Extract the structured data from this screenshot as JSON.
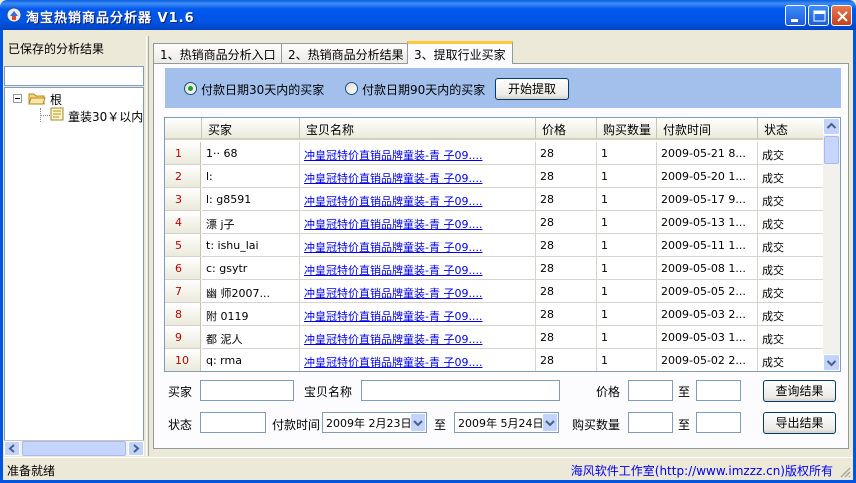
{
  "window": {
    "title": "淘宝热销商品分析器 V1.6"
  },
  "left_panel": {
    "label": "已保存的分析结果",
    "search_value": "",
    "tree": {
      "root": "根",
      "child": "童装30￥以内"
    }
  },
  "tabs": [
    {
      "label": "1、热销商品分析入口"
    },
    {
      "label": "2、热销商品分析结果"
    },
    {
      "label": "3、提取行业买家"
    }
  ],
  "options": {
    "radio1": "付款日期30天内的买家",
    "radio2": "付款日期90天内的买家",
    "selected": "radio1",
    "start_button": "开始提取"
  },
  "grid": {
    "columns": [
      "买家",
      "宝贝名称",
      "价格",
      "购买数量",
      "付款时间",
      "状态"
    ],
    "rows": [
      {
        "num": "1",
        "buyer": "1··  68",
        "item": "冲皇冠特价直销品牌童装-青     子09....",
        "price": "28",
        "qty": "1",
        "time": "2009-05-21 8...",
        "status": "成交"
      },
      {
        "num": "2",
        "buyer": "l:",
        "item": "冲皇冠特价直销品牌童装-青     子09....",
        "price": "28",
        "qty": "1",
        "time": "2009-05-20 1...",
        "status": "成交"
      },
      {
        "num": "3",
        "buyer": "l:   g8591",
        "item": "冲皇冠特价直销品牌童装-青     子09....",
        "price": "28",
        "qty": "1",
        "time": "2009-05-17 9...",
        "status": "成交"
      },
      {
        "num": "4",
        "buyer": "漂    j子",
        "item": "冲皇冠特价直销品牌童装-青     子09....",
        "price": "28",
        "qty": "1",
        "time": "2009-05-13 1...",
        "status": "成交"
      },
      {
        "num": "5",
        "buyer": "t:    ishu_lai",
        "item": "冲皇冠特价直销品牌童装-青     子09....",
        "price": "28",
        "qty": "1",
        "time": "2009-05-11 1...",
        "status": "成交"
      },
      {
        "num": "6",
        "buyer": "c:    gsytr",
        "item": "冲皇冠特价直销品牌童装-青     子09....",
        "price": "28",
        "qty": "1",
        "time": "2009-05-08 1...",
        "status": "成交"
      },
      {
        "num": "7",
        "buyer": "幽    师2007...",
        "item": "冲皇冠特价直销品牌童装-青     子09....",
        "price": "28",
        "qty": "1",
        "time": "2009-05-05 2...",
        "status": "成交"
      },
      {
        "num": "8",
        "buyer": "附    0119",
        "item": "冲皇冠特价直销品牌童装-青     子09....",
        "price": "28",
        "qty": "1",
        "time": "2009-05-03 2...",
        "status": "成交"
      },
      {
        "num": "9",
        "buyer": "都    泥人",
        "item": "冲皇冠特价直销品牌童装-青     子09....",
        "price": "28",
        "qty": "1",
        "time": "2009-05-03 1...",
        "status": "成交"
      },
      {
        "num": "10",
        "buyer": "q:    rma",
        "item": "冲皇冠特价直销品牌童装-青     子09....",
        "price": "28",
        "qty": "1",
        "time": "2009-05-02 2...",
        "status": "成交"
      }
    ]
  },
  "filters": {
    "buyer_label": "买家",
    "item_label": "宝贝名称",
    "price_label": "价格",
    "to_label": "至",
    "status_label": "状态",
    "paytime_label": "付款时间",
    "date_from": "2009年 2月23日",
    "date_to": "2009年 5月24日",
    "qty_label": "购买数量",
    "query_button": "查询结果",
    "export_button": "导出结果"
  },
  "statusbar": {
    "left": "准备就绪",
    "right": "海风软件工作室(http://www.imzzz.cn)版权所有"
  },
  "colors": {
    "titlebar": "#0055E5",
    "option_bar": "#A3C0EC",
    "link": "#0000EE",
    "row_number": "#C00000",
    "active_tab_accent": "#FFC83C"
  }
}
